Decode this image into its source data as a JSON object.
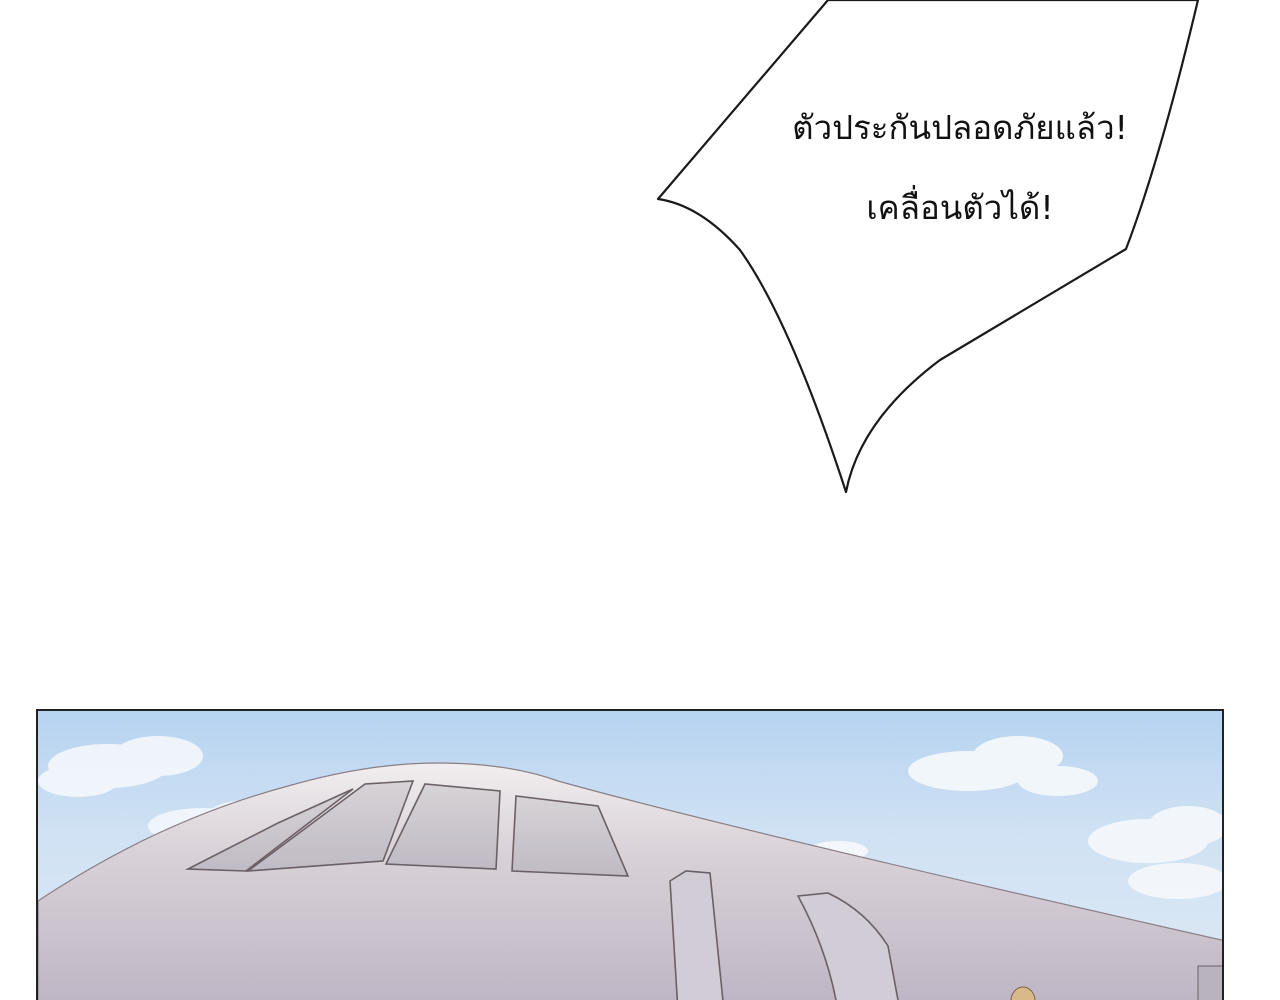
{
  "speech_bubble": {
    "line1": "ตัวประกันปลอดภัยแล้ว!",
    "line2": "เคลื่อนตัวได้!"
  },
  "panel": {
    "subject": "airplane",
    "sky_color": "#c4dbf2",
    "fuselage_color": "#cfc7d1",
    "outline_color": "#222222"
  }
}
